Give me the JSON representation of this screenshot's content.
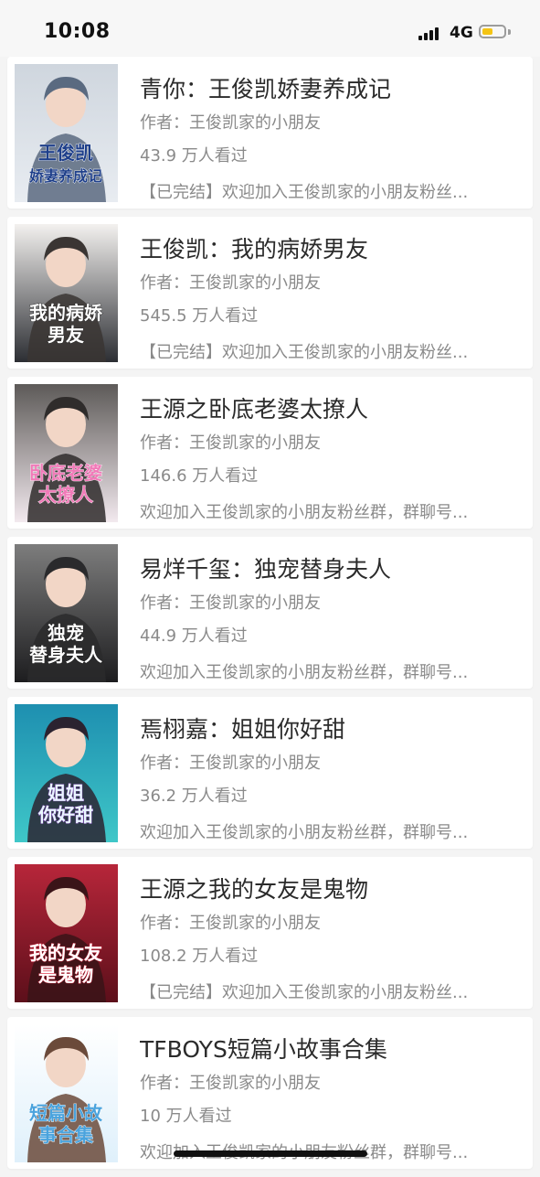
{
  "status_bar": {
    "time": "10:08",
    "network": "4G",
    "battery_level": 0.5,
    "battery_color": "#f4c414"
  },
  "books": [
    {
      "title": "青你：王俊凯娇妻养成记",
      "author": "作者：王俊凯家的小朋友",
      "views": "43.9 万人看过",
      "description": "【已完结】欢迎加入王俊凯家的小朋友粉丝...",
      "cover": {
        "lines": [
          "王俊凯",
          "娇妻养成记"
        ],
        "top": "#cfd6de",
        "bottom": "#e8ecf1",
        "text_color": "#1e3f8a",
        "stroke_color": "#ffffff",
        "figure": "#5a6a80"
      }
    },
    {
      "title": "王俊凯：我的病娇男友",
      "author": "作者：王俊凯家的小朋友",
      "views": "545.5 万人看过",
      "description": "【已完结】欢迎加入王俊凯家的小朋友粉丝...",
      "cover": {
        "lines": [
          "我的病娇",
          "男友"
        ],
        "top": "#f3f1ef",
        "bottom": "#2c2e33",
        "text_color": "#ffffff",
        "stroke_color": "#222222",
        "figure": "#3a3533"
      }
    },
    {
      "title": "王源之卧底老婆太撩人",
      "author": "作者：王俊凯家的小朋友",
      "views": "146.6 万人看过",
      "description": "欢迎加入王俊凯家的小朋友粉丝群，群聊号...",
      "cover": {
        "lines": [
          "卧底老婆",
          "太撩人"
        ],
        "top": "#5d5a58",
        "bottom": "#f2e9ee",
        "text_color": "#f07ab8",
        "stroke_color": "#ffffff",
        "figure": "#2f2c2b"
      }
    },
    {
      "title": "易烊千玺：独宠替身夫人",
      "author": "作者：王俊凯家的小朋友",
      "views": "44.9 万人看过",
      "description": "欢迎加入王俊凯家的小朋友粉丝群，群聊号...",
      "cover": {
        "lines": [
          "独宠",
          "替身夫人"
        ],
        "top": "#7d7d7d",
        "bottom": "#1d1d1f",
        "text_color": "#ffffff",
        "stroke_color": "#111111",
        "figure": "#2a2a2c"
      }
    },
    {
      "title": "焉栩嘉：姐姐你好甜",
      "author": "作者：王俊凯家的小朋友",
      "views": "36.2 万人看过",
      "description": "欢迎加入王俊凯家的小朋友粉丝群，群聊号...",
      "cover": {
        "lines": [
          "姐姐",
          "你好甜"
        ],
        "top": "#1e8fb0",
        "bottom": "#3fc7c8",
        "text_color": "#e9f7ff",
        "stroke_color": "#8b4fc2",
        "figure": "#2b2330"
      }
    },
    {
      "title": "王源之我的女友是鬼物",
      "author": "作者：王俊凯家的小朋友",
      "views": "108.2 万人看过",
      "description": "【已完结】欢迎加入王俊凯家的小朋友粉丝...",
      "cover": {
        "lines": [
          "我的女友",
          "是鬼物"
        ],
        "top": "#b7263a",
        "bottom": "#5c0f1a",
        "text_color": "#ffffff",
        "stroke_color": "#e0324a",
        "figure": "#3a1418"
      }
    },
    {
      "title": "TFBOYS短篇小故事合集",
      "author": "作者：王俊凯家的小朋友",
      "views": "10 万人看过",
      "description": "欢迎加入王俊凯家的小朋友粉丝群，群聊号...",
      "cover": {
        "lines": [
          "短篇小故",
          "事合集"
        ],
        "top": "#ffffff",
        "bottom": "#dff0fb",
        "text_color": "#4aa3dd",
        "stroke_color": "#ffffff",
        "figure": "#6b4a3a"
      }
    }
  ]
}
